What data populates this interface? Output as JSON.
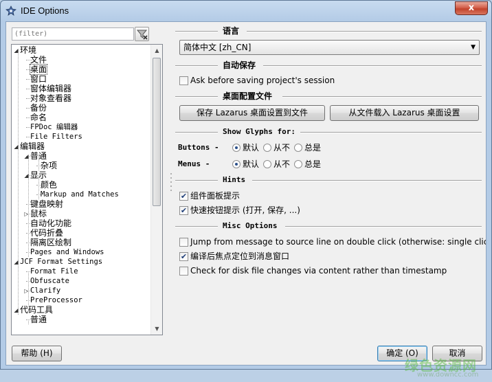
{
  "window": {
    "title": "IDE Options",
    "close_label": "x"
  },
  "filter": {
    "placeholder": "(filter)"
  },
  "tree": {
    "items": [
      {
        "label": "环境",
        "mono": false
      },
      {
        "label": "文件",
        "mono": false
      },
      {
        "label": "桌面",
        "mono": false,
        "selected": true
      },
      {
        "label": "窗口",
        "mono": false
      },
      {
        "label": "窗体编辑器",
        "mono": false
      },
      {
        "label": "对象查看器",
        "mono": false
      },
      {
        "label": "备份",
        "mono": false
      },
      {
        "label": "命名",
        "mono": false
      },
      {
        "label": "FPDoc 编辑器",
        "mono": true
      },
      {
        "label": "File Filters",
        "mono": true
      },
      {
        "label": "编辑器",
        "mono": false
      },
      {
        "label": "普通",
        "mono": false
      },
      {
        "label": "杂项",
        "mono": false
      },
      {
        "label": "显示",
        "mono": false
      },
      {
        "label": "颜色",
        "mono": false
      },
      {
        "label": "Markup and Matches",
        "mono": true
      },
      {
        "label": "键盘映射",
        "mono": false
      },
      {
        "label": "鼠标",
        "mono": false
      },
      {
        "label": "自动化功能",
        "mono": false
      },
      {
        "label": "代码折叠",
        "mono": false
      },
      {
        "label": "隔离区绘制",
        "mono": false
      },
      {
        "label": "Pages and Windows",
        "mono": true
      },
      {
        "label": "JCF Format Settings",
        "mono": true
      },
      {
        "label": "Format File",
        "mono": true
      },
      {
        "label": "Obfuscate",
        "mono": true
      },
      {
        "label": "Clarify",
        "mono": true
      },
      {
        "label": "PreProcessor",
        "mono": true
      },
      {
        "label": "代码工具",
        "mono": false
      },
      {
        "label": "普通",
        "mono": false
      }
    ]
  },
  "language": {
    "heading": "语言",
    "selected": "简体中文 [zh_CN]"
  },
  "autosave": {
    "heading": "自动保存",
    "ask_before_saving": {
      "label": "Ask before saving project's session",
      "checked": false
    }
  },
  "desktop_config": {
    "heading": "桌面配置文件",
    "save_button": "保存 Lazarus 桌面设置到文件",
    "load_button": "从文件载入 Lazarus 桌面设置"
  },
  "glyphs": {
    "heading": "Show Glyphs for:",
    "buttons_label": "Buttons -",
    "menus_label": "Menus -",
    "option_default": "默认",
    "option_never": "从不",
    "option_always": "总是",
    "buttons_value": "默认",
    "menus_value": "默认"
  },
  "hints": {
    "heading": "Hints",
    "palette_hints": {
      "label": "组件面板提示",
      "checked": true
    },
    "speedbutton_hints": {
      "label": "快速按钮提示 (打开, 保存, ...)",
      "checked": true
    }
  },
  "misc": {
    "heading": "Misc Options",
    "jump_from_message": {
      "label": "Jump from message to source line on double click (otherwise: single click",
      "checked": false
    },
    "focus_messages": {
      "label": "编译后焦点定位到消息窗口",
      "checked": true
    },
    "check_disk_changes": {
      "label": "Check for disk file changes via content rather than timestamp",
      "checked": false
    }
  },
  "footer": {
    "help_button": "帮助 (H)",
    "ok_button": "确定 (O)",
    "cancel_button": "取消"
  },
  "watermark": {
    "main": "绿色资源网",
    "sub": "www.downcc.com"
  }
}
